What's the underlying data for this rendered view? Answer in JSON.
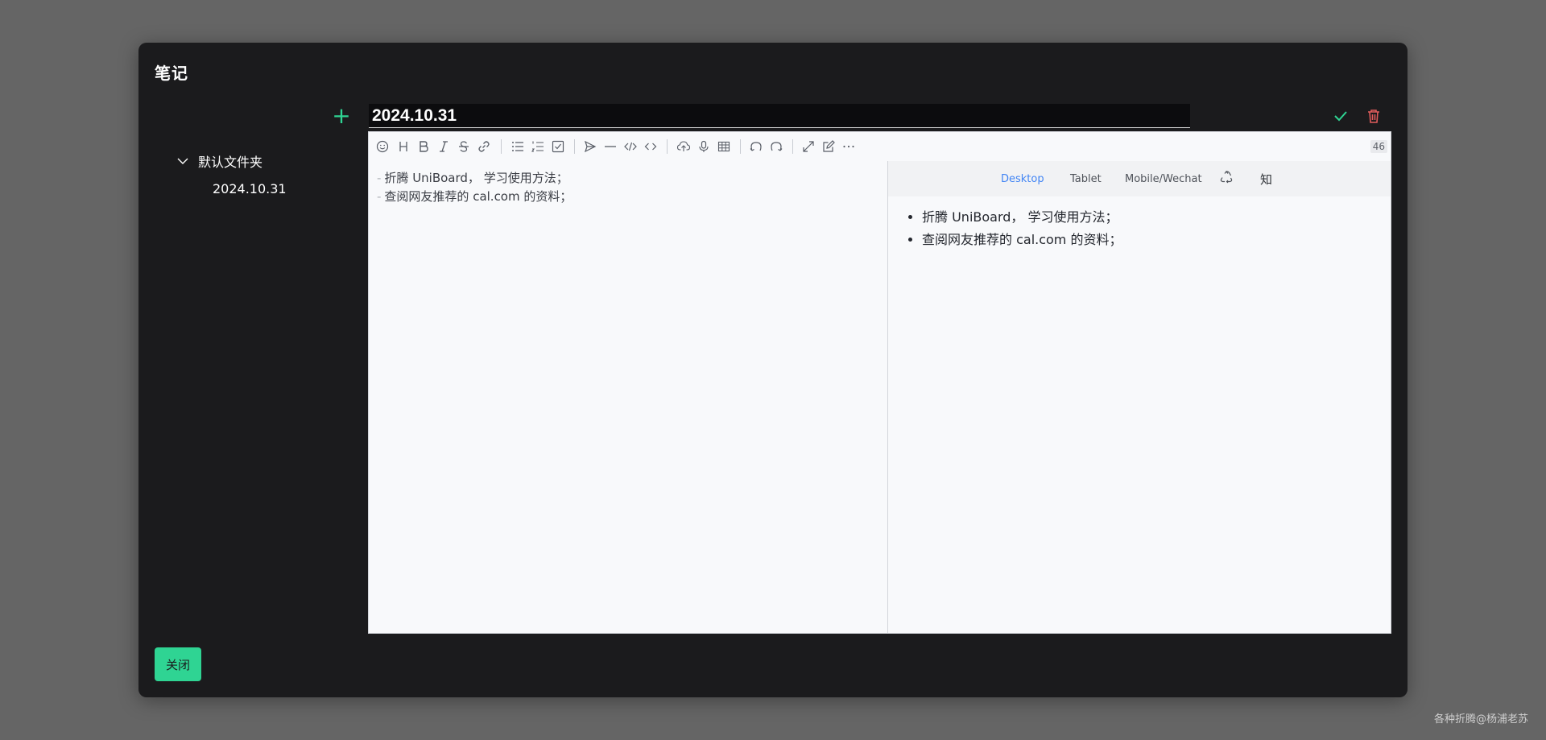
{
  "modal": {
    "title": "笔记",
    "close_label": "关闭"
  },
  "sidebar": {
    "folder_label": "默认文件夹",
    "files": [
      "2024.10.31"
    ]
  },
  "note": {
    "title_value": "2024.10.31"
  },
  "editor": {
    "char_count": "46",
    "source_lines": [
      "折腾 UniBoard， 学习使用方法；",
      "查阅网友推荐的 cal.com 的资料；"
    ],
    "preview_items": [
      "折腾 UniBoard， 学习使用方法；",
      "查阅网友推荐的 cal.com 的资料；"
    ],
    "preview_tabs": {
      "desktop": "Desktop",
      "tablet": "Tablet",
      "mobile": "Mobile/Wechat",
      "zhihu": "知"
    },
    "toolbar_icons": [
      "emoji-icon",
      "headings-icon",
      "bold-icon",
      "italic-icon",
      "strike-icon",
      "link-icon",
      "list-icon",
      "ordered-list-icon",
      "check-icon",
      "quote-icon",
      "line-icon",
      "code-icon",
      "inline-code-icon",
      "upload-icon",
      "record-icon",
      "table-icon",
      "undo-icon",
      "redo-icon",
      "fullscreen-icon",
      "edit-mode-icon",
      "more-icon"
    ]
  },
  "colors": {
    "accent": "#2fd493",
    "danger": "#e25c5c",
    "preview_active": "#4285f4"
  },
  "watermark": "各种折腾@杨浦老苏"
}
